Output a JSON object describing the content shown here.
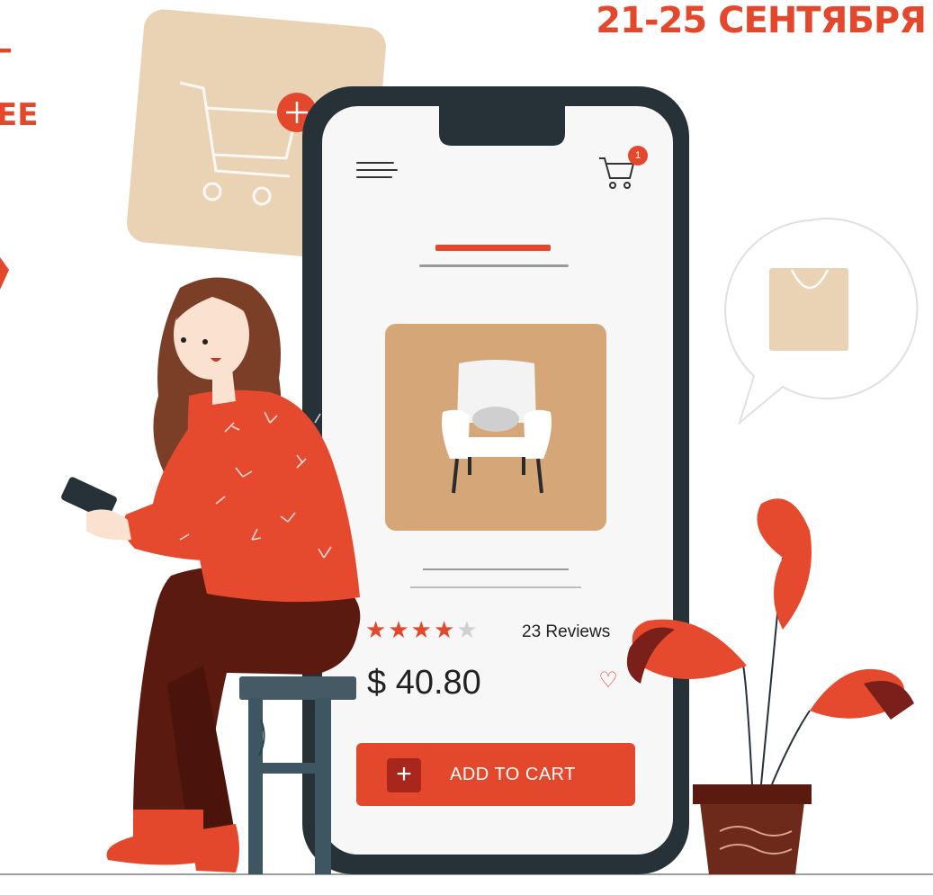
{
  "headline": {
    "dates": "21-25 СЕНТЯБРЯ",
    "left_top": "–",
    "left_bottom": "ЕЕ"
  },
  "colors": {
    "accent": "#e4482c",
    "accent_dark": "#a8261b",
    "card": "#d4a678",
    "phone_frame": "#263238",
    "sweater": "#e64a2e",
    "pants": "#5b1a10",
    "hair": "#7b3f28"
  },
  "phone": {
    "menu_icon": "hamburger-icon",
    "cart_icon": "shopping-cart-icon",
    "cart_badge": "1",
    "product": {
      "image": "armchair",
      "rating": 4,
      "rating_max": 5,
      "reviews": "23 Reviews",
      "price": "$ 40.80",
      "favorite_icon": "heart-icon",
      "favorite_glyph": "♡"
    },
    "add_to_cart": {
      "icon_glyph": "+",
      "label": "ADD TO CART"
    }
  },
  "decor": {
    "cart_card_plus": "+",
    "bubble_icon": "shopping-bag-icon"
  },
  "stars": [
    "★",
    "★",
    "★",
    "★",
    "★"
  ]
}
